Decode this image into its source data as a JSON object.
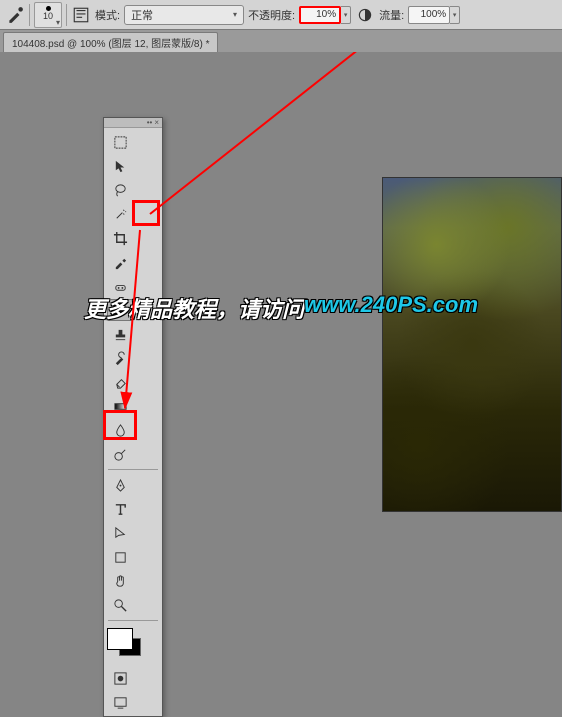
{
  "toolbar": {
    "brush_size": "10",
    "mode_label": "模式:",
    "mode_value": "正常",
    "opacity_label": "不透明度:",
    "opacity_value": "10%",
    "flow_label": "流量:",
    "flow_value": "100%"
  },
  "tab": {
    "title": "104408.psd @ 100% (图层 12, 图层蒙版/8) *"
  },
  "overlay": {
    "text_white": "更多精品教程，请访问 ",
    "text_cyan": "www.240PS.com"
  },
  "icons": {
    "brush": "brush-icon",
    "airbrush": "airbrush-icon",
    "tablet": "tablet-icon",
    "marquee": "marquee-icon",
    "move": "move-icon",
    "lasso": "lasso-icon",
    "wand": "wand-icon",
    "crop": "crop-icon",
    "eyedropper": "eyedropper-icon",
    "heal": "heal-icon",
    "stamp": "stamp-icon",
    "history": "history-brush-icon",
    "eraser": "eraser-icon",
    "gradient": "gradient-icon",
    "blur": "blur-icon",
    "dodge": "dodge-icon",
    "pen": "pen-icon",
    "type": "type-icon",
    "path": "path-select-icon",
    "shape": "shape-icon",
    "hand": "hand-icon",
    "zoom": "zoom-icon"
  },
  "swatch": {
    "fg": "#ffffff",
    "bg": "#000000"
  }
}
